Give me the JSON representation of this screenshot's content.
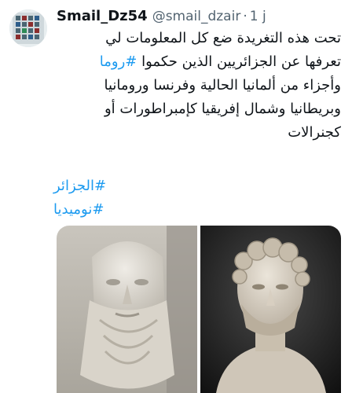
{
  "tweet": {
    "display_name": "Smail_Dz54",
    "handle": "@smail_dzair",
    "separator": "·",
    "time": "1 j",
    "lines": [
      {
        "text": "تحت هذه التغريدة ضع كل المعلومات لي"
      },
      {
        "before": "تعرفها عن الجزائريين الذين حكموا ",
        "hashtag": "#روما"
      },
      {
        "text": "وأجزاء من ألمانيا الحالية وفرنسا ورومانيا"
      },
      {
        "text": "وبريطانيا وشمال إفريقيا كإمبراطورات أو"
      },
      {
        "text": "كجنرالات"
      }
    ],
    "hashtags": [
      "#الجزائر",
      "#نوميديا"
    ]
  },
  "colors": {
    "link": "#1d9bf0",
    "secondary_text": "#536471",
    "primary_text": "#0f1419"
  },
  "media": {
    "images": [
      "bearded-marble-bust",
      "curly-haired-marble-bust"
    ]
  }
}
